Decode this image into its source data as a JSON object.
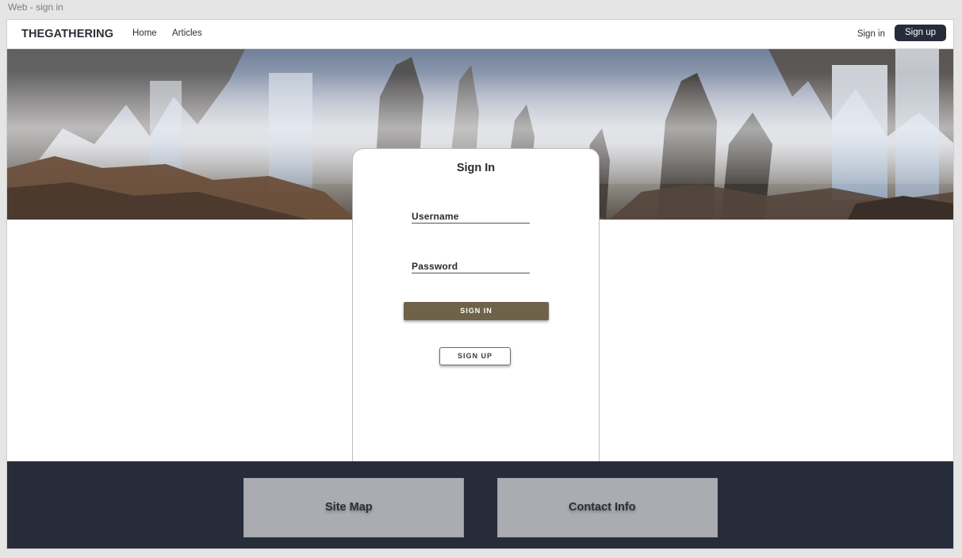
{
  "frame": {
    "label": "Web - sign in"
  },
  "navbar": {
    "brand": "THEGATHERING",
    "links": [
      {
        "label": "Home"
      },
      {
        "label": "Articles"
      }
    ],
    "sign_in_label": "Sign in",
    "sign_up_label": "Sign up"
  },
  "signin_card": {
    "title": "Sign In",
    "username_label": "Username",
    "password_label": "Password",
    "primary_button_label": "SIGN IN",
    "secondary_button_label": "SIGN UP"
  },
  "footer": {
    "sitemap_label": "Site Map",
    "contact_label": "Contact Info"
  },
  "colors": {
    "nav_button_bg": "#272c3a",
    "primary_button_bg": "#6e6249",
    "footer_bg": "#272c3a",
    "footer_box_bg": "#abacb1"
  },
  "icons": {
    "hero_image": "misty-waterfall-landscape-painting"
  }
}
